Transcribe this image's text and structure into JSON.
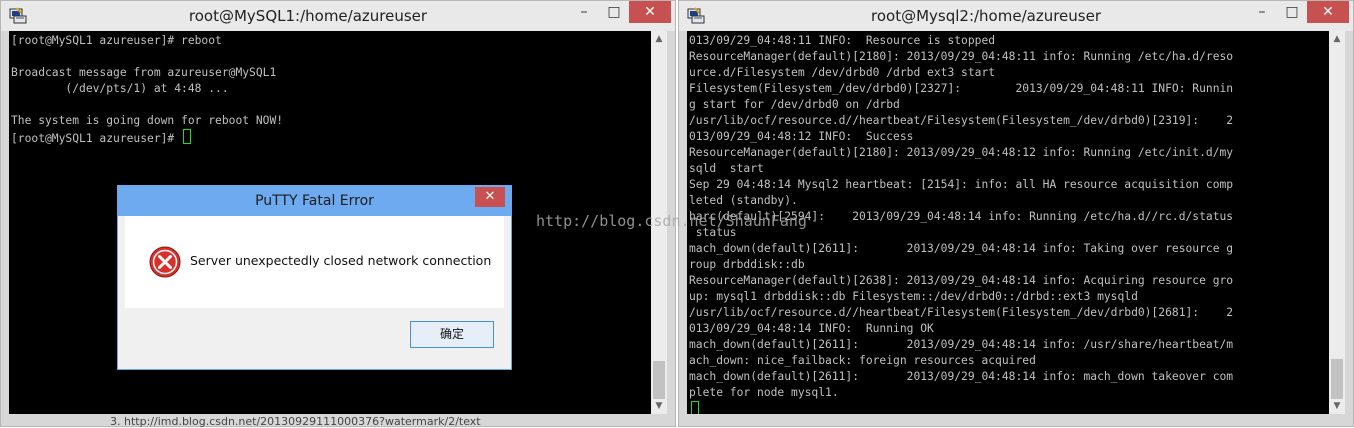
{
  "left_window": {
    "title": "root@MySQL1:/home/azureuser",
    "lines": [
      "[root@MySQL1 azureuser]# reboot",
      "",
      "Broadcast message from azureuser@MySQL1",
      "        (/dev/pts/1) at 4:48 ...",
      "",
      "The system is going down for reboot NOW!",
      "[root@MySQL1 azureuser]# "
    ]
  },
  "right_window": {
    "title": "root@Mysql2:/home/azureuser",
    "lines": [
      "013/09/29_04:48:11 INFO:  Resource is stopped",
      "ResourceManager(default)[2180]: 2013/09/29_04:48:11 info: Running /etc/ha.d/reso",
      "urce.d/Filesystem /dev/drbd0 /drbd ext3 start",
      "Filesystem(Filesystem_/dev/drbd0)[2327]:        2013/09/29_04:48:11 INFO: Runnin",
      "g start for /dev/drbd0 on /drbd",
      "/usr/lib/ocf/resource.d//heartbeat/Filesystem(Filesystem_/dev/drbd0)[2319]:    2",
      "013/09/29_04:48:12 INFO:  Success",
      "ResourceManager(default)[2180]: 2013/09/29_04:48:12 info: Running /etc/init.d/my",
      "sqld  start",
      "Sep 29 04:48:14 Mysql2 heartbeat: [2154]: info: all HA resource acquisition comp",
      "leted (standby).",
      "harc(default)[2594]:    2013/09/29_04:48:14 info: Running /etc/ha.d//rc.d/status",
      " status",
      "mach_down(default)[2611]:       2013/09/29_04:48:14 info: Taking over resource g",
      "roup drbddisk::db",
      "ResourceManager(default)[2638]: 2013/09/29_04:48:14 info: Acquiring resource gro",
      "up: mysql1 drbddisk::db Filesystem::/dev/drbd0::/drbd::ext3 mysqld",
      "/usr/lib/ocf/resource.d//heartbeat/Filesystem(Filesystem_/dev/drbd0)[2681]:    2",
      "013/09/29_04:48:14 INFO:  Running OK",
      "mach_down(default)[2611]:       2013/09/29_04:48:14 info: /usr/share/heartbeat/m",
      "ach_down: nice_failback: foreign resources acquired",
      "mach_down(default)[2611]:       2013/09/29_04:48:14 info: mach_down takeover com",
      "plete for node mysql1.",
      ""
    ]
  },
  "dialog": {
    "title": "PuTTY Fatal Error",
    "close_glyph": "✕",
    "message": "Server unexpectedly closed network connection",
    "ok_label": "确定"
  },
  "window_controls": {
    "minimize": "–",
    "maximize": "□",
    "close": "✕"
  },
  "watermark": "http://blog.csdn.net/ShaunFang",
  "bottom_text": "3. http://imd.blog.csdn.net/20130929111000376?watermark/2/text",
  "icons": [
    "putty-app-icon",
    "error-icon",
    "scroll-up-icon",
    "scroll-down-icon"
  ],
  "colors": {
    "terminal_bg": "#000000",
    "terminal_text": "#c0c0c0",
    "cursor": "#1fdc1f",
    "dialog_title": "#6daaf0",
    "close_button": "#c75050"
  }
}
